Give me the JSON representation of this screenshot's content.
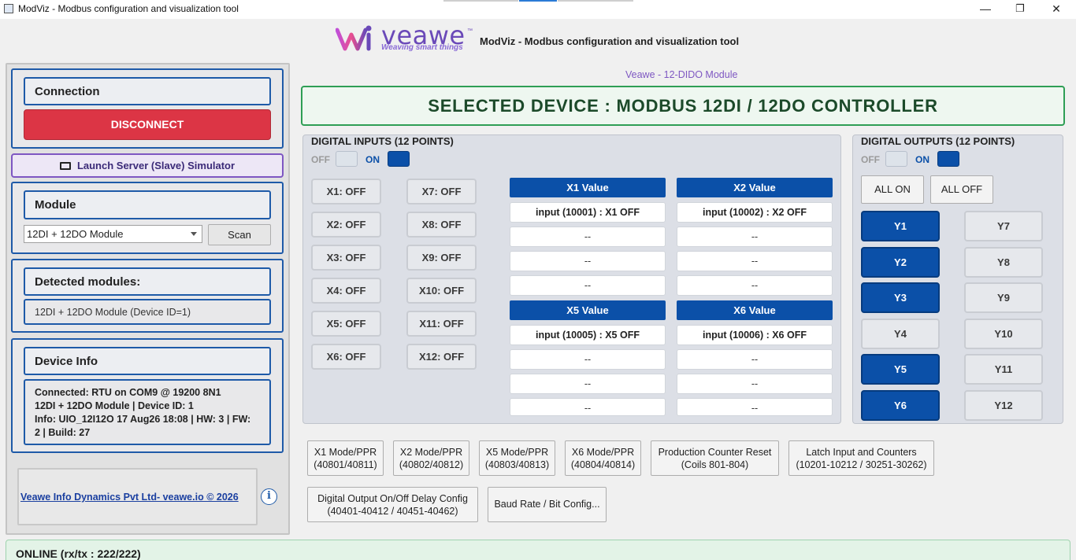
{
  "window": {
    "title": "ModViz - Modbus configuration and visualization tool",
    "minimize": "—",
    "maximize": "❐",
    "close": "✕"
  },
  "header": {
    "logo_word": "veawe",
    "logo_tm": "™",
    "logo_tagline": "Weaving smart things",
    "app_title": "ModViz - Modbus configuration and visualization tool"
  },
  "left": {
    "connection_title": "Connection",
    "disconnect_label": "DISCONNECT",
    "launch_label": "Launch Server (Slave) Simulator",
    "module_title": "Module",
    "module_selected": "12DI + 12DO Module",
    "scan_label": "Scan",
    "detected_title": "Detected modules:",
    "detected_item": "12DI + 12DO Module (Device ID=1)",
    "device_info_title": "Device Info",
    "device_info_lines": [
      "Connected: RTU on COM9 @ 19200 8N1",
      "12DI + 12DO Module | Device ID: 1",
      "Info: UIO_12I12O 17 Aug26 18:08 | HW: 3 | FW:",
      "2 | Build: 27"
    ],
    "footer_link": "Veawe Info Dynamics Pvt Ltd- veawe.io © 2026",
    "info_icon": "i"
  },
  "main": {
    "module_label": "Veawe - 12-DIDO Module",
    "device_banner": "SELECTED DEVICE : MODBUS 12DI / 12DO CONTROLLER",
    "inputs_title": "DIGITAL INPUTS (12 POINTS)",
    "outputs_title": "DIGITAL OUTPUTS (12 POINTS)",
    "off_label": "OFF",
    "on_label": "ON",
    "inputs_col1": [
      "X1: OFF",
      "X2: OFF",
      "X3: OFF",
      "X4: OFF",
      "X5: OFF",
      "X6: OFF"
    ],
    "inputs_col2": [
      "X7: OFF",
      "X8: OFF",
      "X9: OFF",
      "X10: OFF",
      "X11: OFF",
      "X12: OFF"
    ],
    "value_panels": [
      {
        "title": "X1 Value",
        "rows": [
          "input (10001) : X1 OFF",
          "--",
          "--",
          "--"
        ]
      },
      {
        "title": "X2 Value",
        "rows": [
          "input (10002) : X2 OFF",
          "--",
          "--",
          "--"
        ]
      },
      {
        "title": "X5 Value",
        "rows": [
          "input (10005) : X5 OFF",
          "--",
          "--",
          "--"
        ]
      },
      {
        "title": "X6 Value",
        "rows": [
          "input (10006) : X6 OFF",
          "--",
          "--",
          "--"
        ]
      }
    ],
    "all_on_label": "ALL ON",
    "all_off_label": "ALL OFF",
    "outputs_col1": [
      {
        "label": "Y1",
        "state": "on"
      },
      {
        "label": "Y2",
        "state": "on"
      },
      {
        "label": "Y3",
        "state": "on"
      },
      {
        "label": "Y4",
        "state": "off"
      },
      {
        "label": "Y5",
        "state": "on"
      },
      {
        "label": "Y6",
        "state": "on"
      }
    ],
    "outputs_col2": [
      {
        "label": "Y7",
        "state": "off"
      },
      {
        "label": "Y8",
        "state": "off"
      },
      {
        "label": "Y9",
        "state": "off"
      },
      {
        "label": "Y10",
        "state": "off"
      },
      {
        "label": "Y11",
        "state": "off"
      },
      {
        "label": "Y12",
        "state": "off"
      }
    ],
    "config_buttons": [
      {
        "line1": "X1 Mode/PPR",
        "line2": "(40801/40811)"
      },
      {
        "line1": "X2 Mode/PPR",
        "line2": "(40802/40812)"
      },
      {
        "line1": "X5 Mode/PPR",
        "line2": "(40803/40813)"
      },
      {
        "line1": "X6 Mode/PPR",
        "line2": "(40804/40814)"
      },
      {
        "line1": "Production Counter Reset",
        "line2": "(Coils 801-804)"
      },
      {
        "line1": "Latch Input and Counters",
        "line2": "(10201-10212 / 30251-30262)"
      },
      {
        "line1": "Digital Output On/Off Delay Config",
        "line2": "(40401-40412 / 40451-40462)"
      }
    ],
    "baud_button": "Baud Rate / Bit Config..."
  },
  "status": {
    "text": "ONLINE (rx/tx : 222/222)"
  },
  "colors": {
    "accent_blue": "#0b50a8",
    "danger": "#dc3545",
    "brand_purple": "#6a49b8",
    "banner_green": "#2e9e55"
  }
}
